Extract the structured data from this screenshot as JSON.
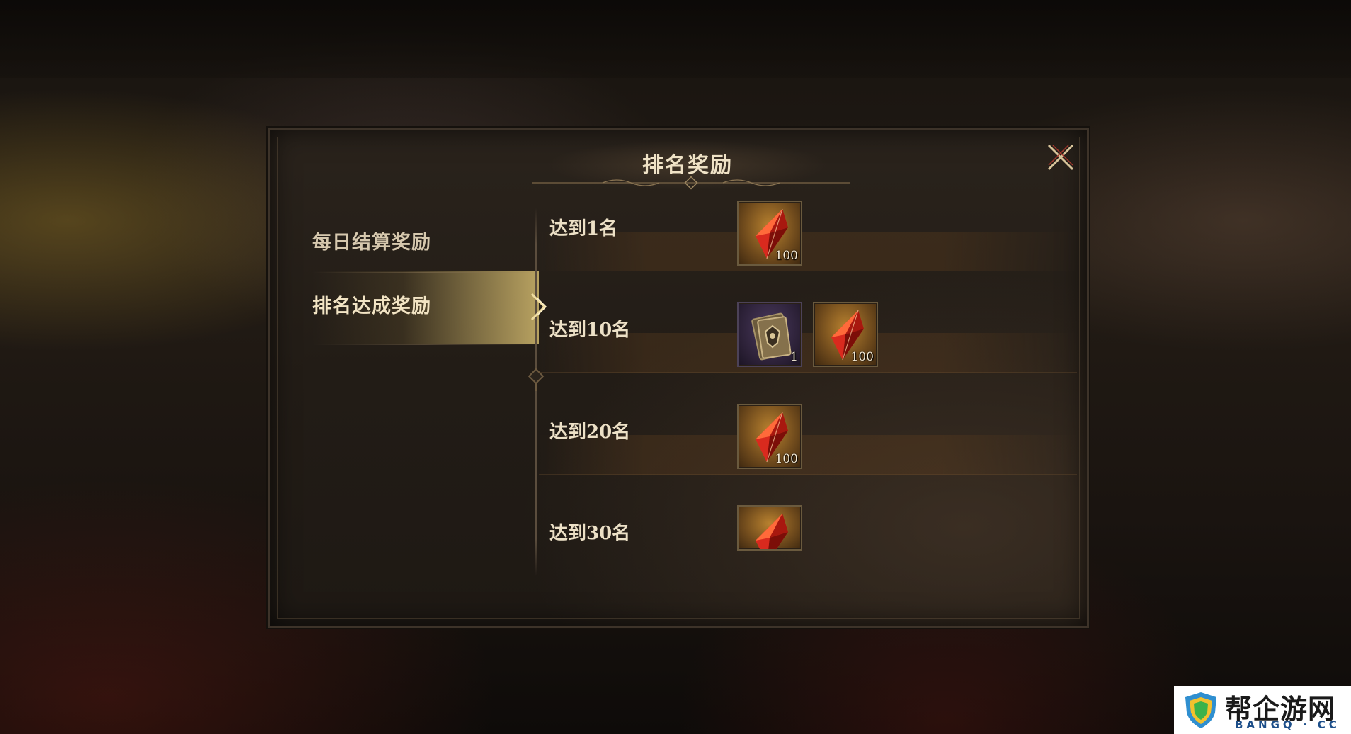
{
  "dialog": {
    "title": "排名奖励",
    "close_icon": "close-x-icon"
  },
  "tabs": [
    {
      "label": "每日结算奖励",
      "active": false
    },
    {
      "label": "排名达成奖励",
      "active": true
    }
  ],
  "rewards": [
    {
      "label": "达到1名",
      "items": [
        {
          "icon": "red-crystal-icon",
          "qty": "100"
        }
      ]
    },
    {
      "label": "达到10名",
      "items": [
        {
          "icon": "tome-icon",
          "qty": "1"
        },
        {
          "icon": "red-crystal-icon",
          "qty": "100"
        }
      ]
    },
    {
      "label": "达到20名",
      "items": [
        {
          "icon": "red-crystal-icon",
          "qty": "100"
        }
      ]
    },
    {
      "label": "达到30名",
      "items": [
        {
          "icon": "red-crystal-icon",
          "qty": ""
        }
      ]
    }
  ],
  "watermark": {
    "title": "帮企游网",
    "subtitle": "BANGQ · CC"
  },
  "colors": {
    "accent_gold": "#d2b96e",
    "text_light": "#ece0c6",
    "crystal_red": "#d92a1e"
  }
}
